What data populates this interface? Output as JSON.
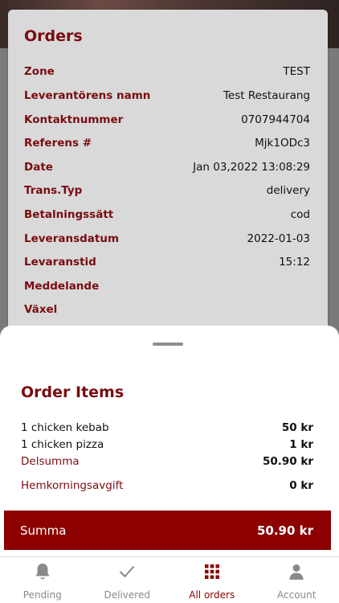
{
  "orders": {
    "title": "Orders",
    "rows": [
      {
        "label": "Zone",
        "value": "TEST"
      },
      {
        "label": "Leverantörens namn",
        "value": "Test Restaurang"
      },
      {
        "label": "Kontaktnummer",
        "value": "0707944704"
      },
      {
        "label": "Referens #",
        "value": "Mjk1ODc3"
      },
      {
        "label": "Date",
        "value": "Jan 03,2022 13:08:29"
      },
      {
        "label": "Trans.Typ",
        "value": "delivery"
      },
      {
        "label": "Betalningssätt",
        "value": "cod"
      },
      {
        "label": "Leveransdatum",
        "value": "2022-01-03"
      },
      {
        "label": "Levaranstid",
        "value": "15:12"
      },
      {
        "label": "Meddelande",
        "value": ""
      },
      {
        "label": "Växel",
        "value": ""
      }
    ]
  },
  "order_items": {
    "title": "Order Items",
    "items": [
      {
        "name": "1 chicken kebab",
        "price": "50 kr"
      },
      {
        "name": "1 chicken pizza",
        "price": "1 kr"
      }
    ],
    "subtotal": {
      "label": "Delsumma",
      "value": "50.90 kr"
    },
    "delivery_fee": {
      "label": "Hemkorningsavgift",
      "value": "0 kr"
    },
    "total": {
      "label": "Summa",
      "value": "50.90 kr"
    }
  },
  "tabbar": {
    "tabs": [
      {
        "label": "Pending",
        "icon": "bell-icon",
        "active": false
      },
      {
        "label": "Delivered",
        "icon": "checkmark-icon",
        "active": false
      },
      {
        "label": "All orders",
        "icon": "grid-icon",
        "active": true
      },
      {
        "label": "Account",
        "icon": "person-icon",
        "active": false
      }
    ]
  },
  "colors": {
    "accent": "#7a0c10",
    "total_bar": "#8c0000",
    "card_bg": "#d9d9d9",
    "inactive_tab": "#8a8a8a"
  }
}
